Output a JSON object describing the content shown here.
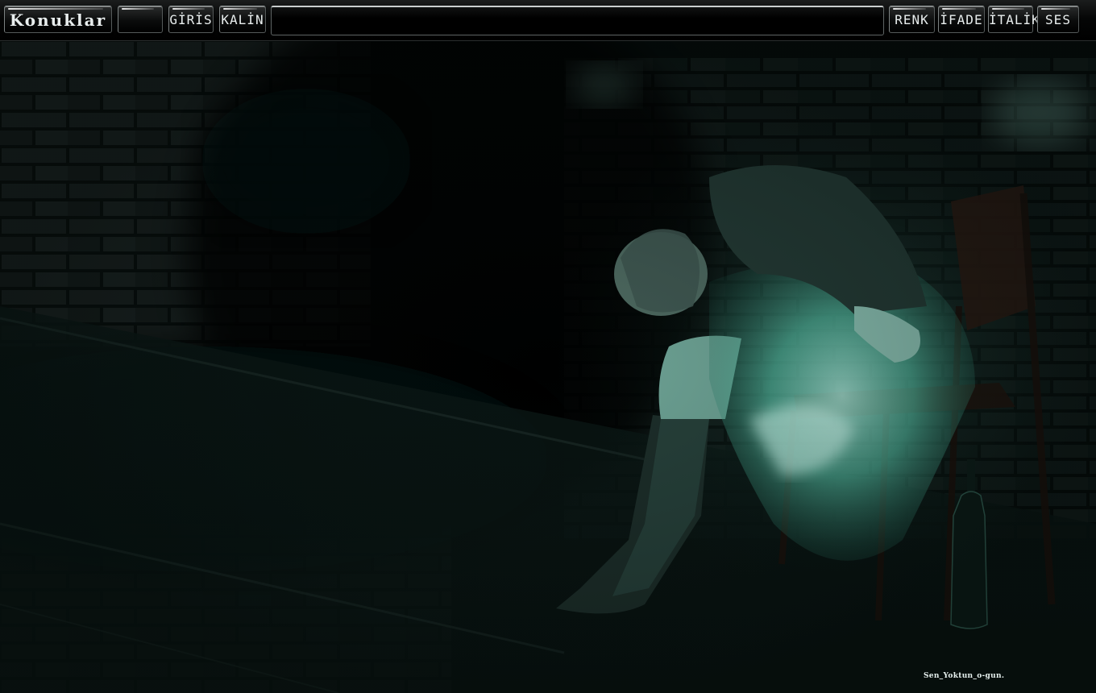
{
  "toolbar": {
    "konuklar_label": "Konuklar",
    "giris_label": "GİRİS",
    "kalin_label": "KALİN",
    "message_value": "",
    "renk_label": "RENK",
    "ifade_label": "İFADE",
    "italik_label": "İTALİK",
    "ses_label": "SES"
  },
  "background": {
    "credit_text": "Sen_Yoktun_o-gun.",
    "accent_color": "#5fe0c4"
  }
}
